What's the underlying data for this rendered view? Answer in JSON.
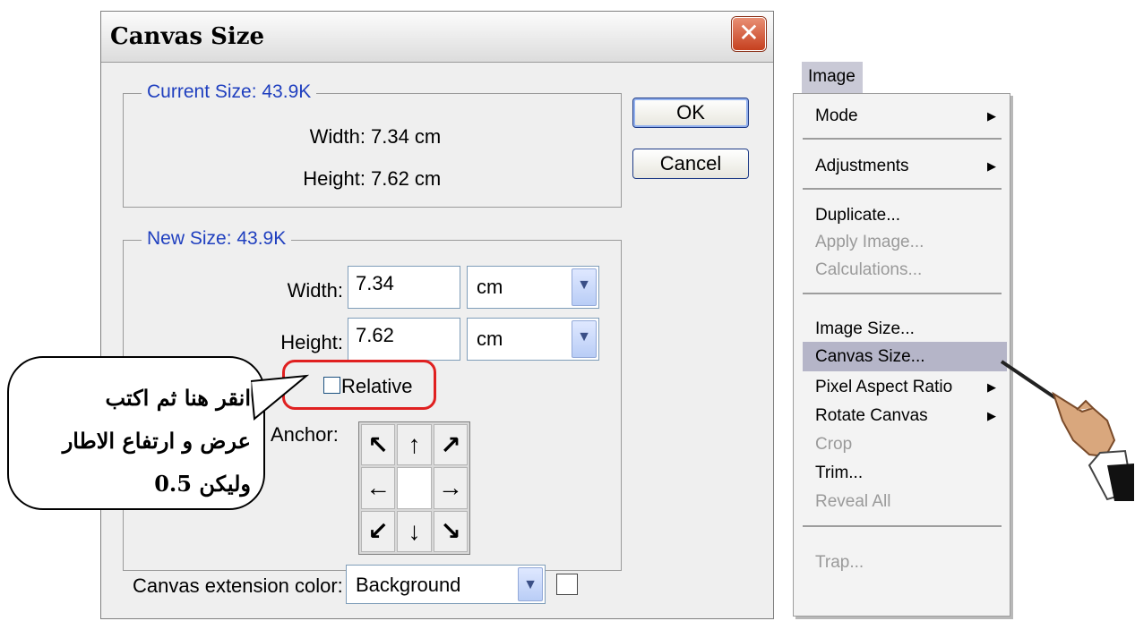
{
  "dialog": {
    "title": "Canvas Size",
    "close_glyph": "✕",
    "current_size": {
      "legend": "Current Size: 43.9K",
      "width_label": "Width:",
      "width_value": "7.34 cm",
      "height_label": "Height:",
      "height_value": "7.62 cm"
    },
    "new_size": {
      "legend": "New Size: 43.9K",
      "width_label": "Width:",
      "width_value": "7.34",
      "width_unit": "cm",
      "height_label": "Height:",
      "height_value": "7.62",
      "height_unit": "cm",
      "relative_label": "Relative",
      "relative_checked": false,
      "anchor_label": "Anchor:",
      "anchor_arrows": [
        "↖",
        "↑",
        "↗",
        "←",
        "",
        "→",
        "↙",
        "↓",
        "↘"
      ]
    },
    "extension_color_label": "Canvas extension color:",
    "extension_color_value": "Background",
    "extension_swatch_color": "#ffffff",
    "ok_label": "OK",
    "cancel_label": "Cancel"
  },
  "callout": {
    "line1": "انقر هنا ثم اكتب",
    "line2": "عرض و ارتفاع الاطار",
    "line3": "وليكن   0.5"
  },
  "menu": {
    "title": "Image",
    "items": [
      {
        "label": "Mode",
        "submenu": true
      },
      {
        "label": "Adjustments",
        "submenu": true
      },
      {
        "label": "Duplicate..."
      },
      {
        "label": "Apply Image...",
        "disabled": true
      },
      {
        "label": "Calculations...",
        "disabled": true
      },
      {
        "label": "Image Size..."
      },
      {
        "label": "Canvas Size...",
        "selected": true
      },
      {
        "label": "Pixel Aspect Ratio",
        "submenu": true
      },
      {
        "label": "Rotate Canvas",
        "submenu": true
      },
      {
        "label": "Crop",
        "disabled": true
      },
      {
        "label": "Trim..."
      },
      {
        "label": "Reveal All",
        "disabled": true
      },
      {
        "label": "Trap...",
        "disabled": true
      }
    ],
    "submenu_glyph": "▶"
  },
  "colors": {
    "legend_text": "#1f3fbf",
    "highlight": "#e02020",
    "menu_selected": "#b5b5c8"
  }
}
